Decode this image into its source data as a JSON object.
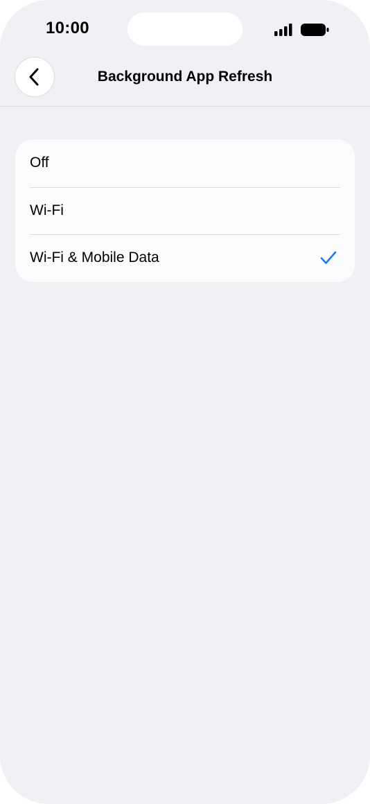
{
  "status_bar": {
    "time": "10:00",
    "icons": [
      "signal-icon",
      "battery-icon"
    ]
  },
  "nav": {
    "back_icon": "chevron-left-icon",
    "title": "Background App Refresh"
  },
  "options": [
    {
      "label": "Off",
      "selected": false
    },
    {
      "label": "Wi-Fi",
      "selected": false
    },
    {
      "label": "Wi-Fi & Mobile Data",
      "selected": true
    }
  ],
  "colors": {
    "background": "#f1f0f5",
    "card": "#fcfcfd",
    "accent": "#1a7cf5"
  }
}
